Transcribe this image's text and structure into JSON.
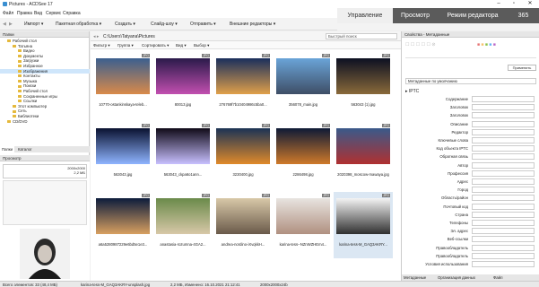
{
  "window": {
    "title": "Pictures - ACDSee 17"
  },
  "menu": [
    "Файл",
    "Правка",
    "Вид",
    "Сервис",
    "Справка"
  ],
  "modes": [
    "Управление",
    "Просмотр",
    "Режим редактора",
    "365"
  ],
  "toolbar": [
    "Импорт ▾",
    "Пакетная обработка ▾",
    "Создать ▾",
    "Слайд-шоу ▾",
    "Отправить ▾",
    "Внешние редакторы ▾"
  ],
  "left": {
    "folders_title": "Папки",
    "tree": [
      {
        "label": "Рабочий стол",
        "indent": 0
      },
      {
        "label": "Татьяна",
        "indent": 1
      },
      {
        "label": "Видео",
        "indent": 2
      },
      {
        "label": "Документы",
        "indent": 2
      },
      {
        "label": "Загрузки",
        "indent": 2
      },
      {
        "label": "Избранное",
        "indent": 2
      },
      {
        "label": "Изображения",
        "indent": 2,
        "selected": true
      },
      {
        "label": "Контакты",
        "indent": 2
      },
      {
        "label": "Музыка",
        "indent": 2
      },
      {
        "label": "Поиски",
        "indent": 2
      },
      {
        "label": "Рабочий стол",
        "indent": 2
      },
      {
        "label": "Сохраненные игры",
        "indent": 2
      },
      {
        "label": "Ссылки",
        "indent": 2
      },
      {
        "label": "Этот компьютер",
        "indent": 1
      },
      {
        "label": "Сеть",
        "indent": 1
      },
      {
        "label": "Библиотеки",
        "indent": 1
      },
      {
        "label": "CD/DVD",
        "indent": 0
      }
    ],
    "tabs": [
      "Папки",
      "Каталог"
    ],
    "preview_title": "Просмотр",
    "preview_size": "2000x2000",
    "preview_filesize": "2,2 МБ"
  },
  "center": {
    "path": "C:\\Users\\Tatyana\\Pictures",
    "search_placeholder": "Быстрый поиск",
    "filters": [
      "Фильтр ▾",
      "Группа ▾",
      "Сортировать ▾",
      "Вид ▾",
      "Выбор ▾"
    ],
    "badge": "JPG",
    "images": [
      {
        "name": "10770-ostankinskaya-teleb...",
        "colors": [
          "#3b5f8f",
          "#d98a4a"
        ]
      },
      {
        "name": "80013.jpg",
        "colors": [
          "#2a1a4a",
          "#c24fb0"
        ]
      },
      {
        "name": "276769f7b10404986c5ba0...",
        "colors": [
          "#1a2f5c",
          "#e0a04a"
        ]
      },
      {
        "name": "356078_main.jpg",
        "colors": [
          "#6aa4d8",
          "#3e4e66"
        ]
      },
      {
        "name": "563043 (1).jpg",
        "colors": [
          "#0c1022",
          "#8a6a3a"
        ]
      },
      {
        "name": "563043.jpg",
        "colors": [
          "#0a1230",
          "#8fb4ff"
        ]
      },
      {
        "name": "563043_ckpa6o1ann...",
        "colors": [
          "#100a18",
          "#c8c0ff"
        ]
      },
      {
        "name": "3230400.jpg",
        "colors": [
          "#1b3355",
          "#e08a2a"
        ]
      },
      {
        "name": "2286498.jpg",
        "colors": [
          "#0e1a36",
          "#cf7a2a"
        ]
      },
      {
        "name": "2020398_moscow-mawaya.jpg",
        "colors": [
          "#3a5a8a",
          "#b03030"
        ]
      },
      {
        "name": "a6a5280987229e6bd5e1e3...",
        "colors": [
          "#0c1c3c",
          "#d8a060"
        ]
      },
      {
        "name": "anastasia-rozumna-4GA2...",
        "colors": [
          "#6a8a4a",
          "#d8c8a8"
        ]
      },
      {
        "name": "andrea-nordino-iXvqkkH...",
        "colors": [
          "#d8c8a8",
          "#6a5a4a"
        ]
      },
      {
        "name": "karina-tess--NZnWZHEm4...",
        "colors": [
          "#e8e4e0",
          "#b09080"
        ]
      },
      {
        "name": "karina-tess-M_GAQ3AKRY...",
        "colors": [
          "#f4f4f4",
          "#303030"
        ],
        "selected": true
      }
    ]
  },
  "right": {
    "title": "Свойства - Метаданные",
    "apply_label": "Применить",
    "preset": "Метаданные по умолчанию",
    "section": "IPTC",
    "fields": [
      "Содержание",
      "Заголовок",
      "Заголовок",
      "Описание",
      "Редактор",
      "Ключевые слова",
      "Код объекта IPTC",
      "Обратная связь",
      "Автор",
      "Профессия",
      "Адрес",
      "Город",
      "Область/район",
      "Почтовый код",
      "Страна",
      "Телефоны",
      "Эл. адрес",
      "Веб-ссылки",
      "Правообладатель",
      "Правообладатель",
      "Условия использования"
    ],
    "tabs": [
      "Метаданные",
      "Организация данных",
      "Файл"
    ]
  },
  "status": {
    "count": "Всего элементов: 33 (48,4 МБ)",
    "file": "karina-tess-M_GAQ3AKRY-unsplash.jpg",
    "info": "2,2 МБ, Изменено: 16.10.2021 21:12:41",
    "dims": "2000x2000x24b"
  }
}
